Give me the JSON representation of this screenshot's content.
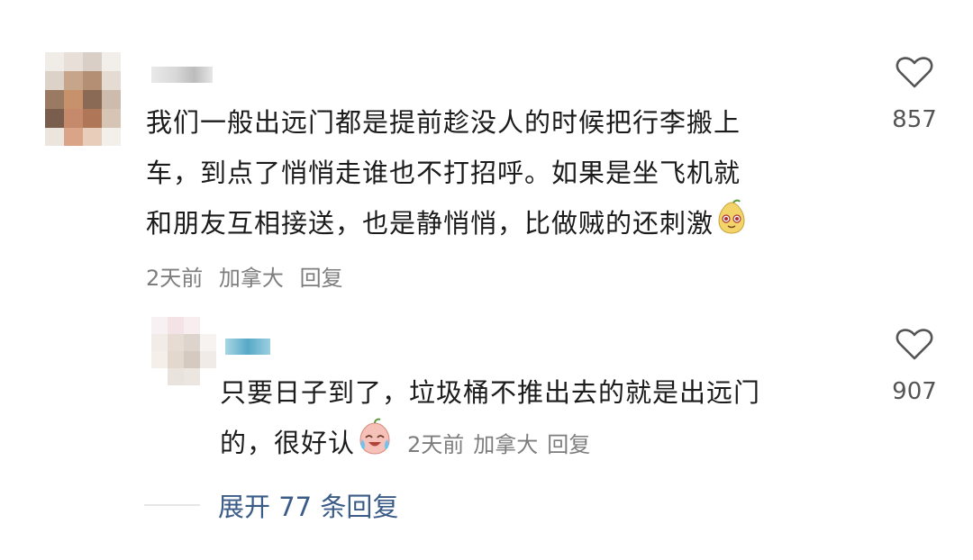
{
  "comment": {
    "text_lines": [
      "我们一般出远门都是提前趁没人的时候把行李搬上",
      "车，到点了悄悄走谁也不打招呼。如果是坐飞机就",
      "和朋友互相接送，也是静悄悄，比做贼的还刺激"
    ],
    "time": "2天前",
    "location": "加拿大",
    "reply_label": "回复",
    "like_count": "857",
    "emoji_icon": "pear-face-emoji-icon"
  },
  "reply": {
    "text_lines": [
      "只要日子到了，垃圾桶不推出去的就是出远门",
      "的，很好认"
    ],
    "time": "2天前",
    "location": "加拿大",
    "reply_label": "回复",
    "like_count": "907",
    "emoji_icon": "crying-laugh-emoji-icon"
  },
  "expand_replies": "展开 77 条回复",
  "colors": {
    "text": "#1b1b1b",
    "meta": "#7d7d7d",
    "link": "#3a5b87",
    "heart_stroke": "#555555"
  }
}
